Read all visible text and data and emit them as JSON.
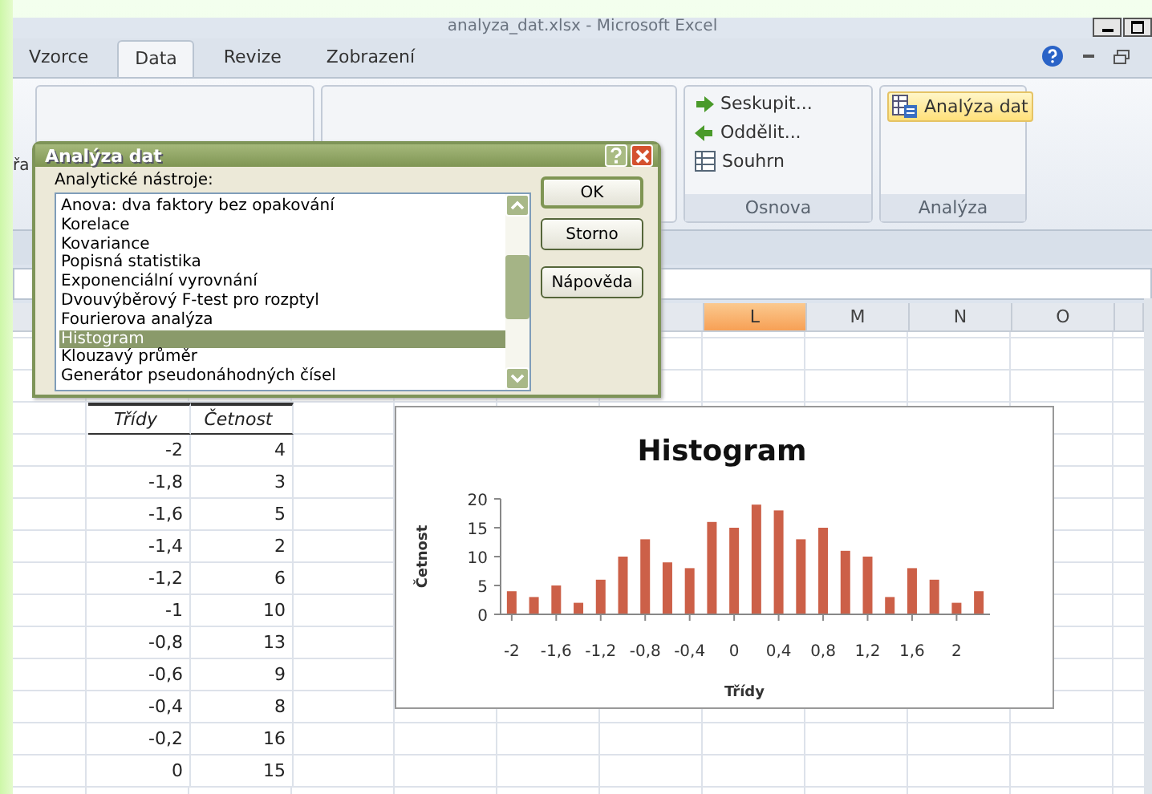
{
  "window": {
    "title": "analyza_dat.xlsx - Microsoft Excel"
  },
  "tabs": [
    {
      "label": "Vzorce",
      "selected": false
    },
    {
      "label": "Data",
      "selected": true
    },
    {
      "label": "Revize",
      "selected": false
    },
    {
      "label": "Zobrazení",
      "selected": false
    }
  ],
  "ribbon": {
    "partial_label": "řa",
    "groups": [
      {
        "label": "Osnova",
        "items": [
          {
            "label": "Seskupit...",
            "kind": "group"
          },
          {
            "label": "Oddělit...",
            "kind": "ungroup"
          },
          {
            "label": "Souhrn",
            "kind": "subtotal"
          }
        ]
      },
      {
        "label": "Analýza",
        "items": [
          {
            "label": "Analýza dat",
            "kind": "analysis"
          }
        ]
      }
    ]
  },
  "dialog": {
    "title": "Analýza dat",
    "list_label": "Analytické nástroje:",
    "tools": [
      {
        "label": "Anova: dva faktory bez opakování",
        "selected": false
      },
      {
        "label": "Korelace",
        "selected": false
      },
      {
        "label": "Kovariance",
        "selected": false
      },
      {
        "label": "Popisná statistika",
        "selected": false
      },
      {
        "label": "Exponenciální vyrovnání",
        "selected": false
      },
      {
        "label": "Dvouvýběrový F-test pro rozptyl",
        "selected": false
      },
      {
        "label": "Fourierova analýza",
        "selected": false
      },
      {
        "label": "Histogram",
        "selected": true
      },
      {
        "label": "Klouzavý průměr",
        "selected": false
      },
      {
        "label": "Generátor pseudonáhodných čísel",
        "selected": false
      }
    ],
    "buttons": [
      "OK",
      "Storno",
      "Nápověda"
    ]
  },
  "column_headers": [
    {
      "label": "L",
      "selected": true
    },
    {
      "label": "M",
      "selected": false
    },
    {
      "label": "N",
      "selected": false
    },
    {
      "label": "O",
      "selected": false
    }
  ],
  "table": {
    "columns": [
      "Třídy",
      "Četnost"
    ],
    "rows": [
      [
        "-2",
        "4"
      ],
      [
        "-1,8",
        "3"
      ],
      [
        "-1,6",
        "5"
      ],
      [
        "-1,4",
        "2"
      ],
      [
        "-1,2",
        "6"
      ],
      [
        "-1",
        "10"
      ],
      [
        "-0,8",
        "13"
      ],
      [
        "-0,6",
        "9"
      ],
      [
        "-0,4",
        "8"
      ],
      [
        "-0,2",
        "16"
      ],
      [
        "0",
        "15"
      ]
    ]
  },
  "chart": {
    "chart_data": {
      "type": "bar",
      "title": "Histogram",
      "xlabel": "Třídy",
      "ylabel": "Četnost",
      "values": [
        4,
        3,
        5,
        2,
        6,
        10,
        13,
        9,
        8,
        16,
        15,
        19,
        18,
        13,
        15,
        11,
        10,
        3,
        8,
        6,
        2,
        4
      ],
      "xlim": [
        -2.1,
        2.3
      ],
      "ylim": [
        0,
        20
      ],
      "yticks": [
        0,
        5,
        10,
        15,
        20
      ],
      "x": [
        -2,
        -1.8,
        -1.6,
        -1.4,
        -1.2,
        -1,
        -0.8,
        -0.6,
        -0.4,
        -0.2,
        0,
        0.2,
        0.4,
        0.6,
        0.8,
        1,
        1.2,
        1.4,
        1.6,
        1.8,
        2,
        2.2
      ],
      "xticks": [
        {
          "value": -2,
          "label": "-2"
        },
        {
          "value": -1.6,
          "label": "-1,6"
        },
        {
          "value": -1.2,
          "label": "-1,2"
        },
        {
          "value": -0.8,
          "label": "-0,8"
        },
        {
          "value": -0.4,
          "label": "-0,4"
        },
        {
          "value": 0,
          "label": "0"
        },
        {
          "value": 0.4,
          "label": "0,4"
        },
        {
          "value": 0.8,
          "label": "0,8"
        },
        {
          "value": 1.2,
          "label": "1,2"
        },
        {
          "value": 1.6,
          "label": "1,6"
        },
        {
          "value": 2,
          "label": "2"
        }
      ]
    }
  }
}
